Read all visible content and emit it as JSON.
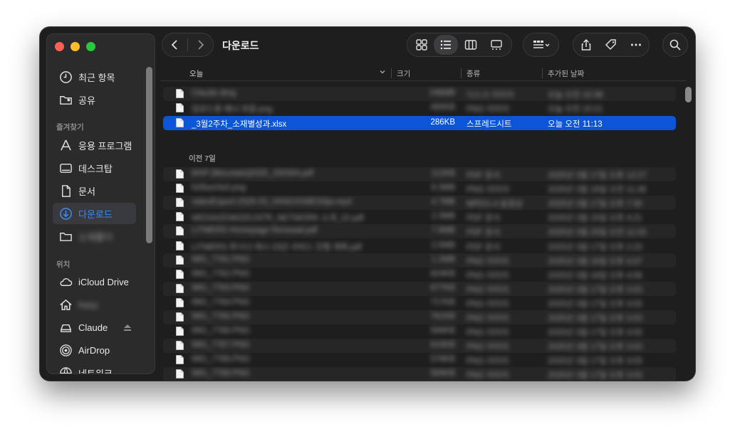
{
  "window": {
    "title": "다운로드"
  },
  "sidebar": {
    "recents_label": "최근 항목",
    "shared_label": "공유",
    "favorites_heading": "즐겨찾기",
    "favorites": [
      {
        "label": "응용 프로그램",
        "icon": "apps-icon"
      },
      {
        "label": "데스크탑",
        "icon": "desktop-icon"
      },
      {
        "label": "문서",
        "icon": "document-icon"
      },
      {
        "label": "다운로드",
        "icon": "downloads-icon",
        "active": true
      },
      {
        "label": "소재폴더",
        "icon": "folder-icon",
        "blurred": true
      }
    ],
    "locations_heading": "위치",
    "locations": [
      {
        "label": "iCloud Drive",
        "icon": "cloud-icon"
      },
      {
        "label": "hsey",
        "icon": "home-icon",
        "blurred": true
      },
      {
        "label": "Claude",
        "icon": "drive-icon"
      },
      {
        "label": "AirDrop",
        "icon": "airdrop-icon"
      },
      {
        "label": "네트워크",
        "icon": "network-icon"
      }
    ]
  },
  "columns": {
    "name": "오늘",
    "size": "크기",
    "kind": "종류",
    "date": "추가된 날짜"
  },
  "groups": {
    "today": "오늘",
    "prev7": "이전 7일"
  },
  "today_rows": [
    {
      "name": "Claude.dmg",
      "size": "248MB",
      "kind": "디스크 이미지",
      "date": "오늘 오전 10:38",
      "blurred": true
    },
    {
      "name": "업로드용 배너 최종.png",
      "size": "465KB",
      "kind": "PNG 이미지",
      "date": "오늘 오전 10:21",
      "blurred": true
    },
    {
      "name": "_3월2주차_소재별성과.xlsx",
      "size": "286KB",
      "kind": "스프레드시트",
      "date": "오늘 오전 11:13",
      "selected": true
    }
  ],
  "prev_rows": [
    {
      "name": "MXP [Mountain]2025_250304.pdf",
      "size": "112KB",
      "kind": "PDF 문서",
      "date": "2025년 3월 17일 오후 12:27"
    },
    {
      "name": "fx0fuer0x0.png",
      "size": "8.3MB",
      "kind": "PNG 이미지",
      "date": "2025년 3월 16일 오전 11:36"
    },
    {
      "name": "videoExport-2025-03_04StOXS8ES0jw.mp4",
      "size": "4.7MB",
      "kind": "MPEG-4 동영상",
      "date": "2025년 3월 17일 오후 7:30"
    },
    {
      "name": "MEDIAZENKEEUSTR_NETWORK 소개_22.pdf",
      "size": "2.3MB",
      "kind": "PDF 문서",
      "date": "2025년 3월 15일 오후 4:21"
    },
    {
      "name": "LITMERS Homepage Renewal.pdf",
      "size": "7.8MB",
      "kind": "PDF 문서",
      "date": "2025년 3월 20일 오전 11:03"
    },
    {
      "name": "LITMERS 루시너 캐시 23년 서비스 진행 계획.pdf",
      "size": "2.5MB",
      "kind": "PDF 문서",
      "date": "2025년 3월 17일 오후 2:23"
    },
    {
      "name": "IMG_7761.PNG",
      "size": "1.2MB",
      "kind": "PNG 이미지",
      "date": "2025년 3월 16일 오후 4:07"
    },
    {
      "name": "IMG_7762.PNG",
      "size": "824KB",
      "kind": "PNG 이미지",
      "date": "2025년 3월 16일 오후 4:06"
    },
    {
      "name": "IMG_7763.PNG",
      "size": "677KB",
      "kind": "PNG 이미지",
      "date": "2025년 3월 17일 오후 3:03"
    },
    {
      "name": "IMG_7764.PNG",
      "size": "717KB",
      "kind": "PNG 이미지",
      "date": "2025년 3월 17일 오후 3:03"
    },
    {
      "name": "IMG_7765.PNG",
      "size": "761KB",
      "kind": "PNG 이미지",
      "date": "2025년 3월 17일 오후 3:03"
    },
    {
      "name": "IMG_7766.PNG",
      "size": "566KB",
      "kind": "PNG 이미지",
      "date": "2025년 3월 17일 오후 3:03"
    },
    {
      "name": "IMG_7767.PNG",
      "size": "610KB",
      "kind": "PNG 이미지",
      "date": "2025년 3월 17일 오후 3:03"
    },
    {
      "name": "IMG_7768.PNG",
      "size": "578KB",
      "kind": "PNG 이미지",
      "date": "2025년 3월 17일 오후 3:03"
    },
    {
      "name": "IMG_7769.PNG",
      "size": "584KB",
      "kind": "PNG 이미지",
      "date": "2025년 3월 17일 오후 3:03"
    }
  ],
  "colors": {
    "accent": "#0a56d6",
    "sidebar_active_text": "#3f8cf6"
  }
}
